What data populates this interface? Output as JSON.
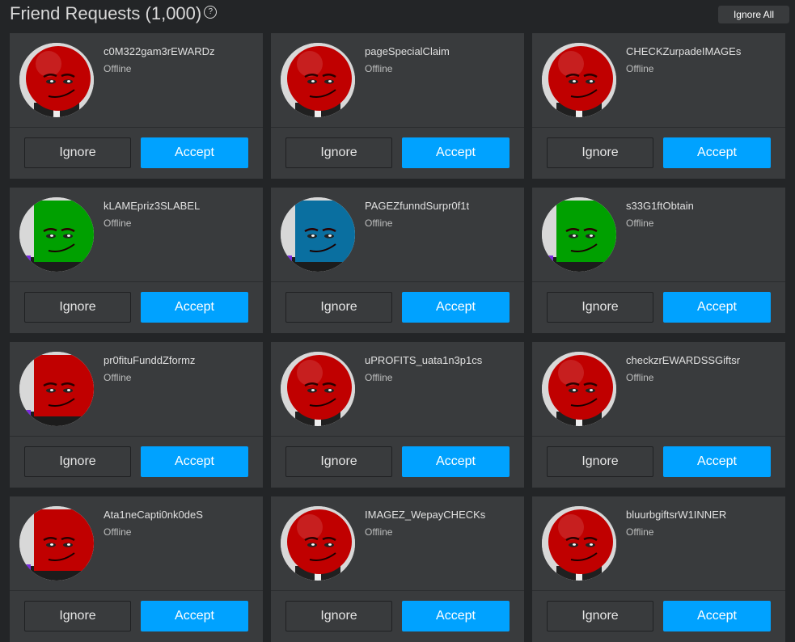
{
  "header": {
    "title": "Friend Requests (1,000)",
    "help_glyph": "?",
    "ignore_all_label": "Ignore All"
  },
  "buttons": {
    "ignore_label": "Ignore",
    "accept_label": "Accept"
  },
  "colors": {
    "accent": "#00a2ff",
    "background": "#232527",
    "card": "#393b3d"
  },
  "requests": [
    {
      "username": "c0M322gam3rEWARDz",
      "status": "Offline",
      "avatar": "red-round-head",
      "avatar_color": "#c00000"
    },
    {
      "username": "pageSpecialClaim",
      "status": "Offline",
      "avatar": "red-round-head",
      "avatar_color": "#c00000"
    },
    {
      "username": "CHECKZurpadeIMAGEs",
      "status": "Offline",
      "avatar": "red-round-head",
      "avatar_color": "#c00000"
    },
    {
      "username": "kLAMEpriz3SLABEL",
      "status": "Offline",
      "avatar": "green-block-head",
      "avatar_color": "#00a000"
    },
    {
      "username": "PAGEZfunndSurpr0f1t",
      "status": "Offline",
      "avatar": "blue-block-head",
      "avatar_color": "#0a6fa0"
    },
    {
      "username": "s33G1ftObtain",
      "status": "Offline",
      "avatar": "green-block-head",
      "avatar_color": "#00a000"
    },
    {
      "username": "pr0fituFunddZformz",
      "status": "Offline",
      "avatar": "red-block-head",
      "avatar_color": "#c00000"
    },
    {
      "username": "uPROFITS_uata1n3p1cs",
      "status": "Offline",
      "avatar": "red-round-head",
      "avatar_color": "#c00000"
    },
    {
      "username": "checkzrEWARDSSGiftsr",
      "status": "Offline",
      "avatar": "red-round-head",
      "avatar_color": "#c00000"
    },
    {
      "username": "Ata1neCapti0nk0deS",
      "status": "Offline",
      "avatar": "red-block-head",
      "avatar_color": "#c00000"
    },
    {
      "username": "IMAGEZ_WepayCHECKs",
      "status": "Offline",
      "avatar": "red-round-head",
      "avatar_color": "#c00000"
    },
    {
      "username": "bluurbgiftsrW1INNER",
      "status": "Offline",
      "avatar": "red-round-head",
      "avatar_color": "#c00000"
    }
  ]
}
